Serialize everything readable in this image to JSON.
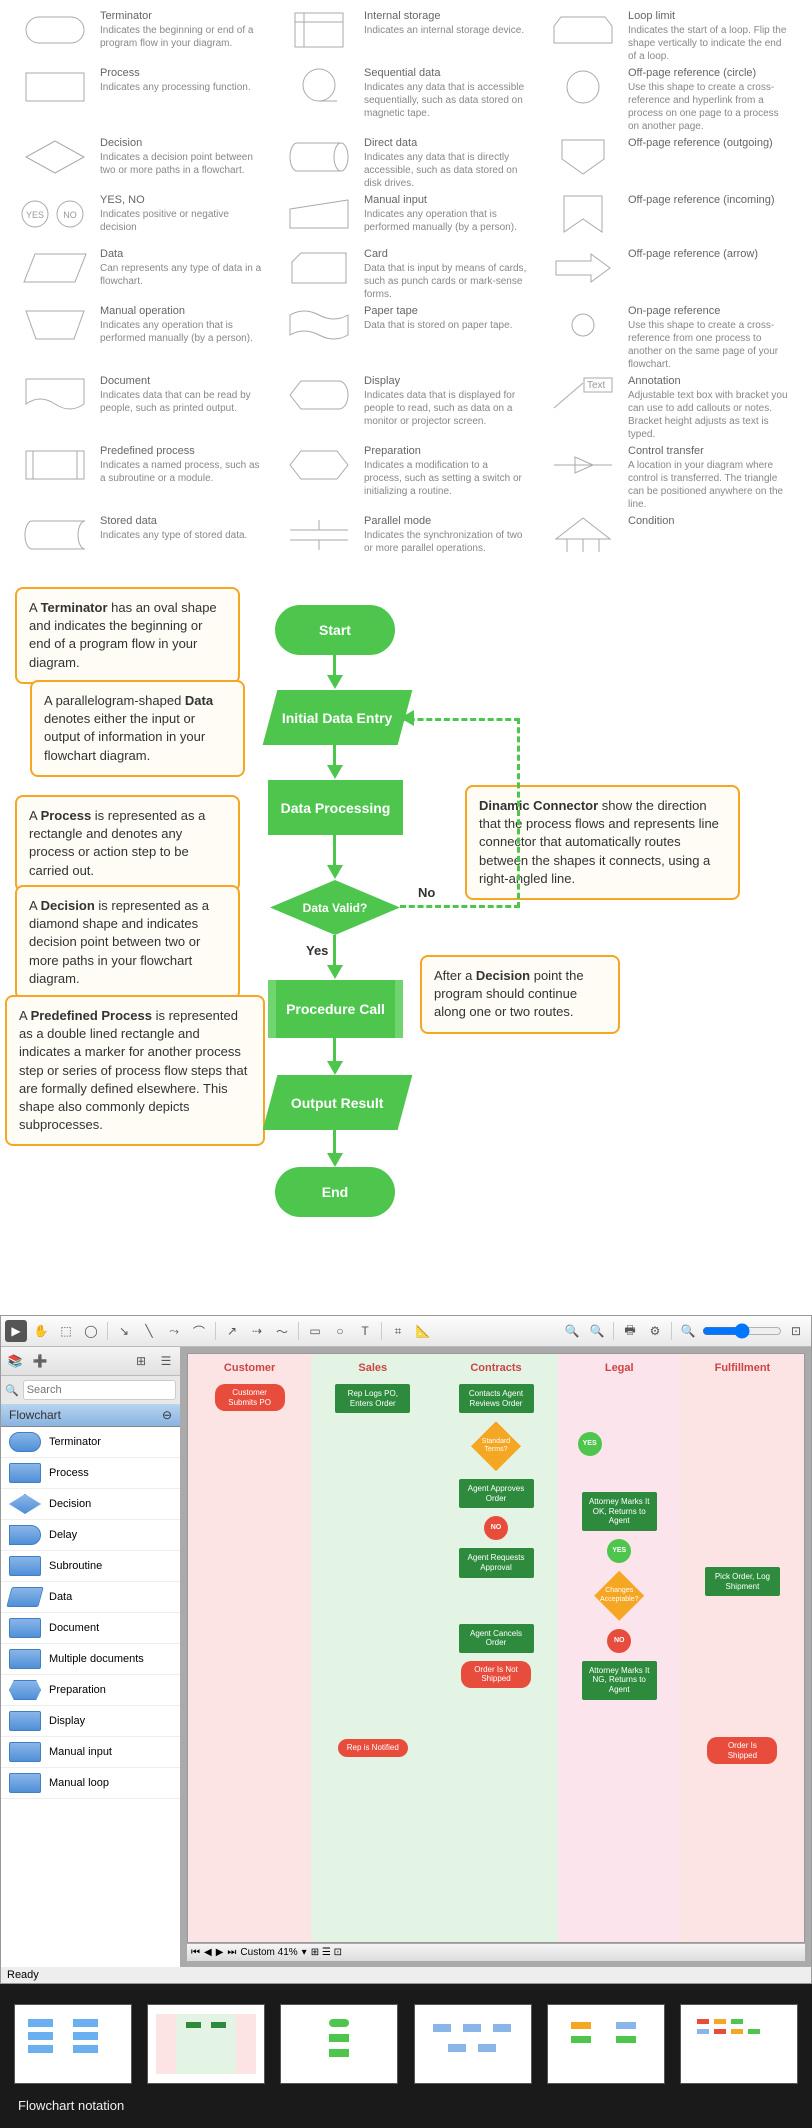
{
  "shapes": {
    "col1": [
      {
        "title": "Terminator",
        "desc": "Indicates the beginning or end of a program flow in your diagram."
      },
      {
        "title": "Process",
        "desc": "Indicates any processing function."
      },
      {
        "title": "Decision",
        "desc": "Indicates a decision point between two or more paths in a flowchart."
      },
      {
        "title": "YES, NO",
        "desc": "Indicates positive or negative decision"
      },
      {
        "title": "Data",
        "desc": "Can represents any type of data in a flowchart."
      },
      {
        "title": "Manual operation",
        "desc": "Indicates any operation that is performed manually (by a person)."
      },
      {
        "title": "Document",
        "desc": "Indicates data that can be read by people, such as printed output."
      },
      {
        "title": "Predefined process",
        "desc": "Indicates a named process, such as a subroutine or a module."
      },
      {
        "title": "Stored data",
        "desc": "Indicates any type of stored data."
      }
    ],
    "col2": [
      {
        "title": "Internal storage",
        "desc": "Indicates an internal storage device."
      },
      {
        "title": "Sequential data",
        "desc": "Indicates any data that is accessible sequentially, such as data stored on magnetic tape."
      },
      {
        "title": "Direct data",
        "desc": "Indicates any data that is directly accessible, such as data stored on disk drives."
      },
      {
        "title": "Manual input",
        "desc": "Indicates any operation that is performed manually (by a person)."
      },
      {
        "title": "Card",
        "desc": "Data that is input by means of cards, such as punch cards or mark-sense forms."
      },
      {
        "title": "Paper tape",
        "desc": "Data that is stored on paper tape."
      },
      {
        "title": "Display",
        "desc": "Indicates data that is displayed for people to read, such as data on a monitor or projector screen."
      },
      {
        "title": "Preparation",
        "desc": "Indicates a modification to a process, such as setting a switch or initializing a routine."
      },
      {
        "title": "Parallel mode",
        "desc": "Indicates the synchronization of two or more parallel operations."
      }
    ],
    "col3": [
      {
        "title": "Loop limit",
        "desc": "Indicates the start of a loop. Flip the shape vertically to indicate the end of a loop."
      },
      {
        "title": "Off-page reference (circle)",
        "desc": "Use this shape to create a cross-reference and hyperlink from a process on one page to a process on another page."
      },
      {
        "title": "Off-page reference (outgoing)",
        "desc": ""
      },
      {
        "title": "Off-page reference (incoming)",
        "desc": ""
      },
      {
        "title": "Off-page reference (arrow)",
        "desc": ""
      },
      {
        "title": "On-page reference",
        "desc": "Use this shape to create a cross-reference from one process to another on the same page of your flowchart."
      },
      {
        "title": "Annotation",
        "desc": "Adjustable text box with bracket you can use to add callouts or notes. Bracket height adjusts as text is typed."
      },
      {
        "title": "Control transfer",
        "desc": "A location in your diagram where control is transferred. The triangle can be positioned anywhere on the line."
      },
      {
        "title": "Condition",
        "desc": ""
      }
    ],
    "annotation_text": "Text",
    "yes": "YES",
    "no": "NO"
  },
  "annotated": {
    "callouts": {
      "terminator": "A <b>Terminator</b> has an oval shape and indicates the beginning or end of a program flow in your diagram.",
      "data": "A parallelogram-shaped <b>Data</b> denotes either the input or output of information in your flowchart diagram.",
      "process": "A <b>Process</b> is represented as a rectangle and denotes any process or action step to be carried out.",
      "decision": "A <b>Decision</b> is represented as a diamond shape and indicates decision point between two or more paths in your flowchart diagram.",
      "predef": "A <b>Predefined Process</b> is represented as a double lined rectangle and indicates a marker for another process step or series of process flow steps that are formally defined elsewhere. This shape also commonly depicts subprocesses.",
      "connector": "<b>Dinamic Connector</b> show the direction that the process flows and represents line connector that automatically routes between the shapes it connects, using a right-angled line.",
      "after_decision": "After a <b>Decision</b> point the program should continue along one or two routes."
    },
    "nodes": {
      "start": "Start",
      "initial": "Initial Data Entry",
      "processing": "Data Processing",
      "valid": "Data Valid?",
      "call": "Procedure Call",
      "output": "Output Result",
      "end": "End"
    },
    "labels": {
      "yes": "Yes",
      "no": "No"
    }
  },
  "app": {
    "search_placeholder": "Search",
    "panel_title": "Flowchart",
    "stencils": [
      "Terminator",
      "Process",
      "Decision",
      "Delay",
      "Subroutine",
      "Data",
      "Document",
      "Multiple documents",
      "Preparation",
      "Display",
      "Manual input",
      "Manual loop"
    ],
    "lanes": [
      "Customer",
      "Sales",
      "Contracts",
      "Legal",
      "Fulfillment"
    ],
    "nodes": {
      "customer_submits": "Customer Submits PO",
      "rep_logs": "Rep Logs PO, Enters Order",
      "contacts_agent": "Contacts Agent Reviews Order",
      "standard_terms": "Standard Terms?",
      "yes": "YES",
      "no": "NO",
      "agent_approves": "Agent Approves Order",
      "attorney_marks": "Attorney Marks It OK, Returns to Agent",
      "agent_requests": "Agent Requests Approval",
      "changes": "Changes Acceptable?",
      "pick_order": "Pick Order, Log Shipment",
      "agent_cancels": "Agent Cancels Order",
      "attorney_ng": "Attorney Marks It NG, Returns to Agent",
      "rep_notified": "Rep is Notified",
      "order_not_shipped": "Order Is Not Shipped",
      "order_shipped": "Order Is Shipped"
    },
    "zoom": "Custom 41%",
    "status": "Ready"
  },
  "thumbs": {
    "caption": "Flowchart notation"
  }
}
